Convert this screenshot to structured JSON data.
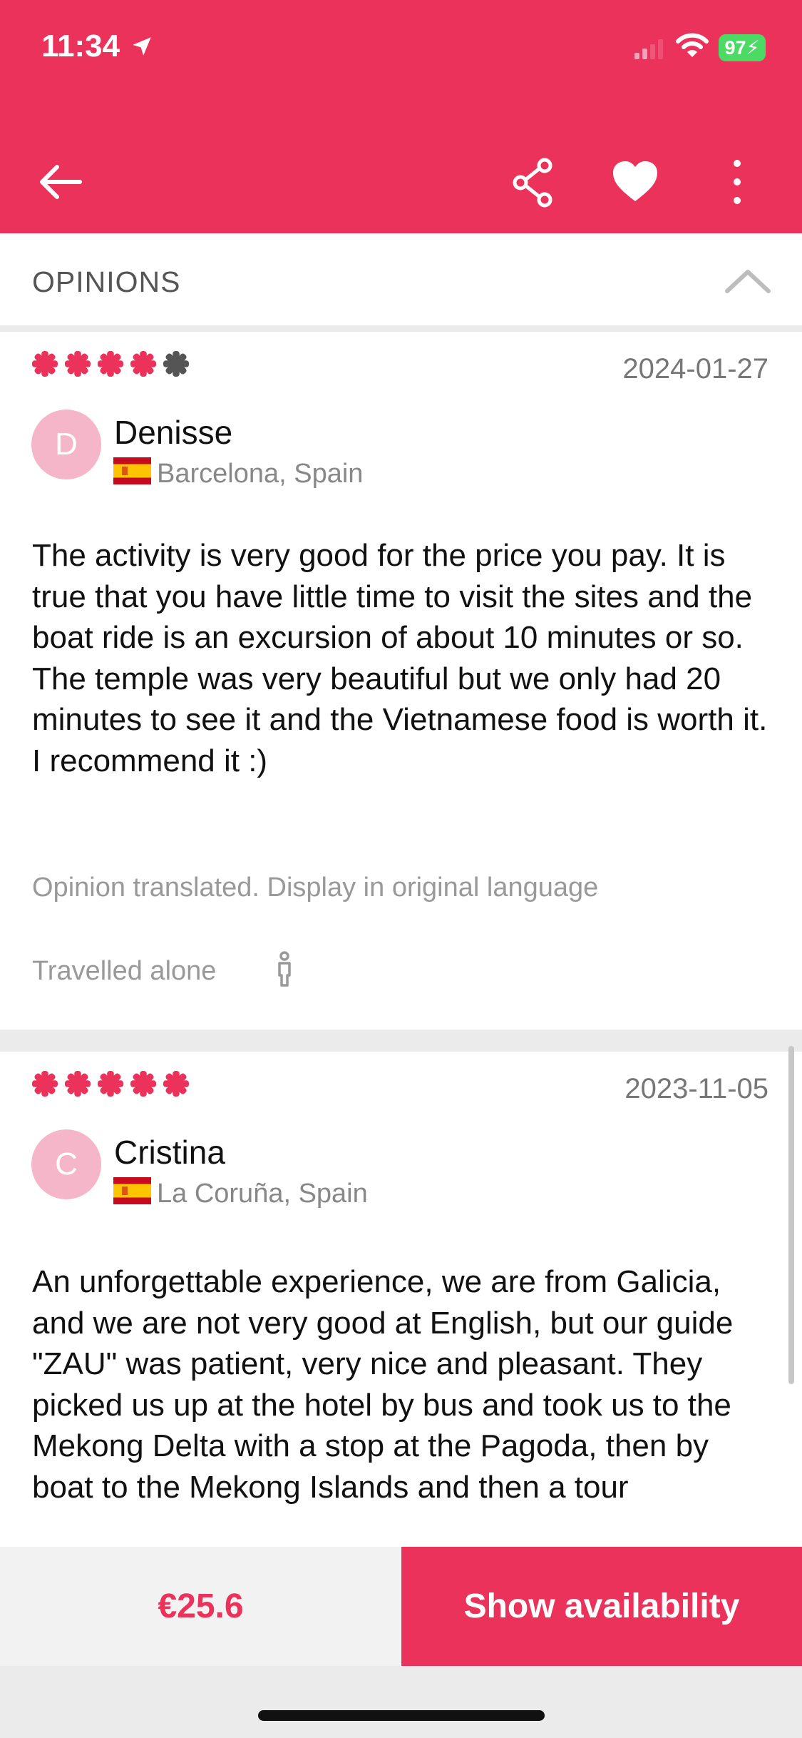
{
  "status_bar": {
    "time": "11:34",
    "battery": "97"
  },
  "section": {
    "title": "OPINIONS"
  },
  "reviews": [
    {
      "rating": 4,
      "date": "2024-01-27",
      "avatar_letter": "D",
      "name": "Denisse",
      "location": "Barcelona, Spain",
      "text": "The activity is very good for the price you pay. It is true that you have little time to visit the sites and the boat ride is an excursion of about 10 minutes or so. The temple was very beautiful but we only had 20 minutes to see it and the Vietnamese food is worth it. I recommend it :)",
      "translated_note": "Opinion translated. Display in original language",
      "travel_type": "Travelled alone"
    },
    {
      "rating": 5,
      "date": "2023-11-05",
      "avatar_letter": "C",
      "name": "Cristina",
      "location": "La Coruña, Spain",
      "text": "An unforgettable experience, we are from Galicia, and we are not very good at English, but our guide \"ZAU\" was patient, very nice and pleasant. They picked us up at the hotel by bus and took us to the Mekong Delta with a stop at the Pagoda, then by boat to the Mekong Islands and then a tour"
    }
  ],
  "booking": {
    "price": "€25.6",
    "cta_label": "Show availability"
  },
  "colors": {
    "accent": "#ea325a",
    "star_inactive": "#555555",
    "avatar_bg": "#f5b6c9"
  }
}
